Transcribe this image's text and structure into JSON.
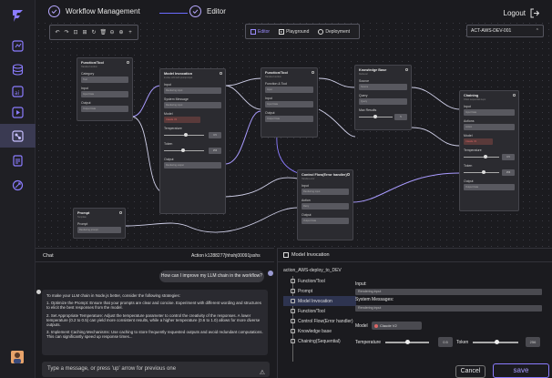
{
  "header": {
    "crumb1": "Workflow Management",
    "crumb2": "Editor",
    "logout": "Logout"
  },
  "toolbar": {
    "tools": [
      "↶",
      "↷",
      "⊡",
      "⊞",
      "↻",
      "🗑",
      "⊖",
      "⊕",
      "+"
    ],
    "modes": [
      {
        "label": "Editor",
        "icon": "editor-icon",
        "active": true
      },
      {
        "label": "Playground",
        "icon": "playground-icon",
        "active": false
      },
      {
        "label": "Deployment",
        "icon": "deployment-icon",
        "active": false
      }
    ],
    "env": "ACT-AWS-DEV-001"
  },
  "nodes": {
    "function_tool_1": {
      "title": "Function/Tool",
      "desc": "Handles function",
      "f1": "Category",
      "f1v": "Tool",
      "f2": "Input",
      "f2v": "Input Data",
      "f3": "Output",
      "f3v": "Output Data"
    },
    "model_invocation": {
      "title": "Model Invocation",
      "desc": "Invoke LLM with prompt input",
      "f1": "Input",
      "f1v": "Rendering input",
      "f2": "System Message",
      "f2v": "Rendering input",
      "f3": "Model",
      "f3v": "Claude V2",
      "f4": "Temperature",
      "f4v": "0.5",
      "f5": "Token",
      "f5v": "256",
      "f6": "Output",
      "f6v": "Rendering output"
    },
    "function_tool_2": {
      "title": "Function/Tool",
      "desc": "Handles function",
      "f1": "Function & Tool",
      "f1v": "Input",
      "f2": "Input",
      "f2v": "Input Data",
      "f3": "Output",
      "f3v": "Output Data"
    },
    "knowledge_base": {
      "title": "Knowledge Base",
      "desc": "Retrieval",
      "f1": "Source",
      "f1v": "Source",
      "f2": "Query",
      "f2v": "Query",
      "f3": "Max Results",
      "f3v": "5"
    },
    "chaining": {
      "title": "Chaining",
      "desc": "Chain sequential steps",
      "f1": "Input",
      "f1v": "Input Data",
      "f2": "Actions",
      "f2v": "Action",
      "f3": "Model",
      "f3v": "Claude V2",
      "f4": "Temperature",
      "f4v": "0.5",
      "f5": "Token",
      "f5v": "256",
      "f6": "Output",
      "f6v": "Output Data"
    },
    "control_flow": {
      "title": "Control Flow(Error handler)",
      "desc": "Handles error",
      "f1": "Input",
      "f1v": "Rendering input",
      "f2": "Action",
      "f2v": "Retry",
      "f3": "Output",
      "f3v": "Output Data"
    },
    "prompt": {
      "title": "Prompt",
      "desc": "Template",
      "f1": "Prompt",
      "f1v": "Rendering prompt"
    }
  },
  "chat": {
    "title": "Chat",
    "action": "Action k1288277jhhshj00091jsshs",
    "user_message": "How can I improve my LLM chain in the workflow?",
    "bot_intro": "To make your LLM chain in Node.js better, consider the following strategies:",
    "bot_points": [
      "1. Optimize the Prompt: Ensure that your prompts are clear and concise. Experiment with different wording and structures to elicit the best responses from the model.",
      "2. Set Appropriate Temperature: Adjust the temperature parameter to control the creativity of the responses. A lower temperature (0.2 to 0.5) can yield more consistent results, while a higher temperature (0.6 to 1.0) allows for more diverse outputs.",
      "3. Implement Caching Mechanisms: Use caching to store frequently requested outputs and avoid redundant computations. This can significantly speed up response times..."
    ],
    "input_placeholder": "Type a message, or press 'up' arrow for previous one"
  },
  "panel": {
    "title": "Model Invocation",
    "tree_root": "action_AWS-deploy_to_DEV",
    "tree_items": [
      {
        "label": "Function/Tool",
        "icon": "function-icon",
        "selected": false
      },
      {
        "label": "Prompt",
        "icon": "prompt-icon",
        "selected": false
      },
      {
        "label": "Model Invocation",
        "icon": "model-icon",
        "selected": true
      },
      {
        "label": "Function/Tool",
        "icon": "function-icon",
        "selected": false
      },
      {
        "label": "Control Flow(Error handler)",
        "icon": "control-flow-icon",
        "selected": false
      },
      {
        "label": "Knowledge base",
        "icon": "knowledge-icon",
        "selected": false
      },
      {
        "label": "Chaining(Sequential)",
        "icon": "chaining-icon",
        "selected": false
      }
    ],
    "input_label": "Input:",
    "input_value": "Rendering input",
    "system_label": "System Messages:",
    "system_value": "Rendering input",
    "model_label": "Model",
    "model_value": "Claude V2",
    "temperature_label": "Temperature",
    "temperature_value": "0.5",
    "token_label": "Token",
    "token_value": "256",
    "cancel": "Cancel",
    "save": "save"
  },
  "colors": {
    "accent": "#8b7cff",
    "bg": "#1b1b1f"
  }
}
